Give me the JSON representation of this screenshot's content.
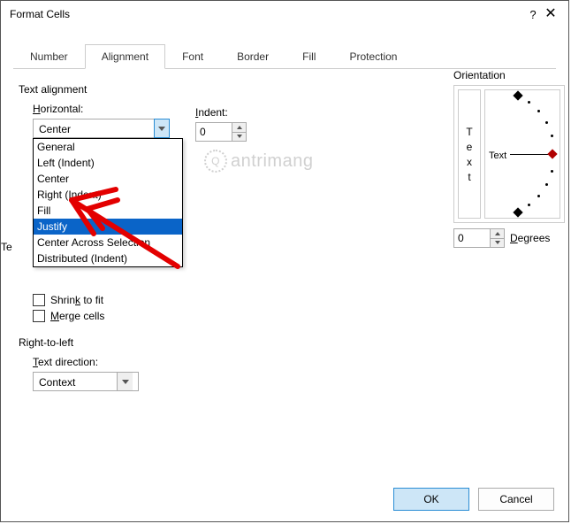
{
  "window": {
    "title": "Format Cells"
  },
  "tabs": {
    "number": "Number",
    "alignment": "Alignment",
    "font": "Font",
    "border": "Border",
    "fill": "Fill",
    "protection": "Protection"
  },
  "alignment": {
    "group_label": "Text alignment",
    "horizontal_label": "Horizontal:",
    "horizontal_value": "Center",
    "horizontal_options": [
      "General",
      "Left (Indent)",
      "Center",
      "Right (Indent)",
      "Fill",
      "Justify",
      "Center Across Selection",
      "Distributed (Indent)"
    ],
    "horizontal_selected_index": 5,
    "indent_label": "Indent:",
    "indent_value": "0",
    "text_control_label": "Text control",
    "shrink_label": "Shrink to fit",
    "merge_label": "Merge cells",
    "rtl_group_label": "Right-to-left",
    "text_direction_label": "Text direction:",
    "text_direction_value": "Context"
  },
  "orientation": {
    "label": "Orientation",
    "vertical_text": "Text",
    "pointer_text": "Text",
    "degrees_value": "0",
    "degrees_label": "Degrees"
  },
  "buttons": {
    "ok": "OK",
    "cancel": "Cancel"
  },
  "watermark": "antrimang"
}
